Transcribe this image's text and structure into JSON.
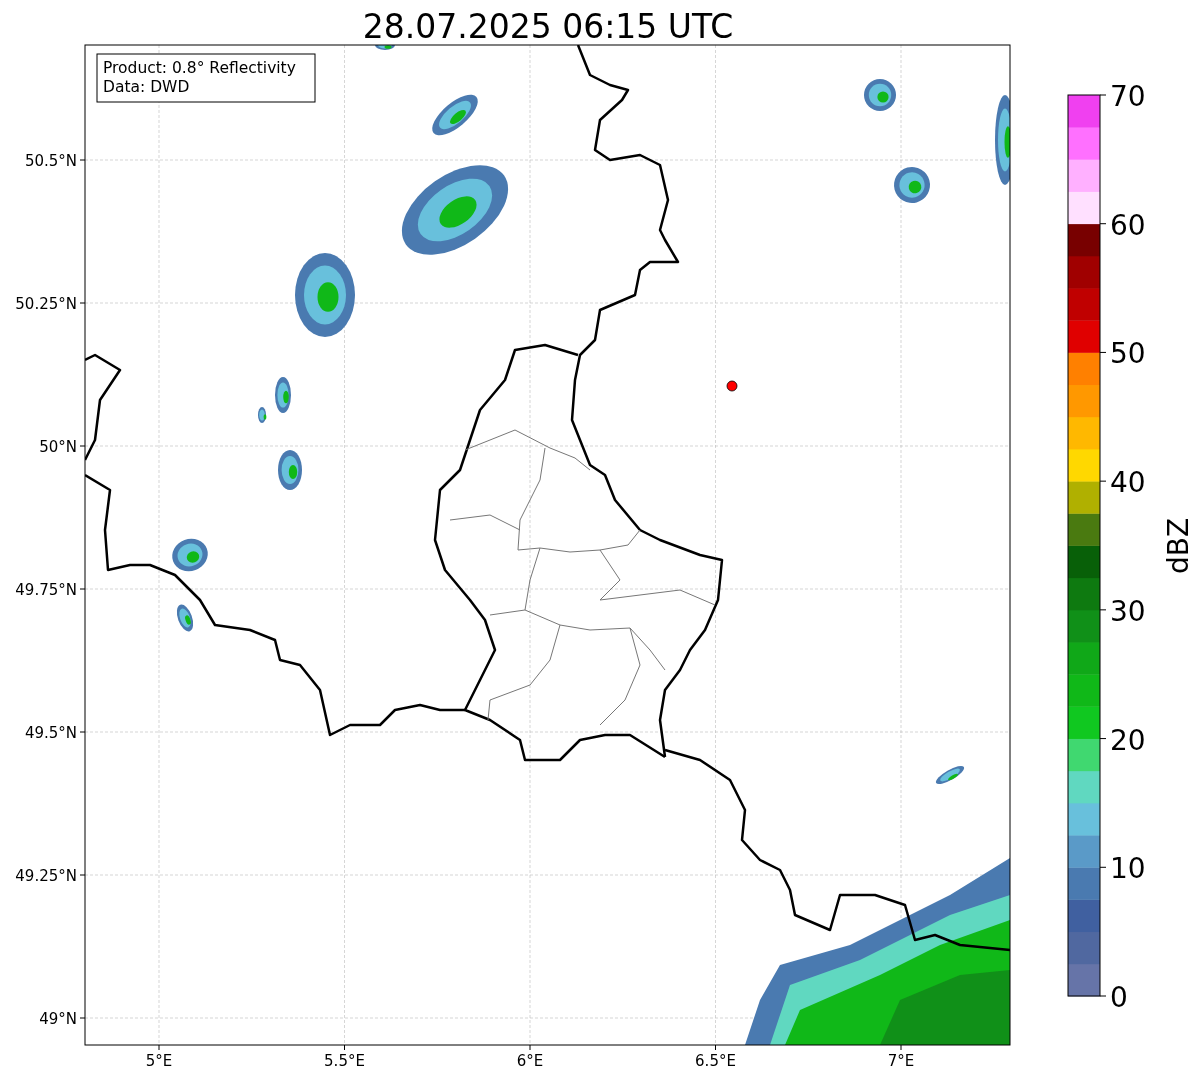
{
  "title": "28.07.2025 06:15 UTC",
  "info_box": [
    "Product: 0.8° Reflectivity",
    "Data: DWD"
  ],
  "map": {
    "x_ticks": [
      "5°E",
      "5.5°E",
      "6°E",
      "6.5°E",
      "7°E"
    ],
    "y_ticks": [
      "50.5°N",
      "50.25°N",
      "50°N",
      "49.75°N",
      "49.5°N",
      "49.25°N",
      "49°N"
    ]
  },
  "colorbar": {
    "label": "dBZ",
    "ticks": [
      "70",
      "60",
      "50",
      "40",
      "30",
      "20",
      "10",
      "0"
    ],
    "segments": [
      {
        "color": "#6674a8"
      },
      {
        "color": "#5068a0"
      },
      {
        "color": "#4060a0"
      },
      {
        "color": "#4a7ab0"
      },
      {
        "color": "#5a9ac8"
      },
      {
        "color": "#68c0dc"
      },
      {
        "color": "#60d8c0"
      },
      {
        "color": "#40d870"
      },
      {
        "color": "#10c820"
      },
      {
        "color": "#10b818"
      },
      {
        "color": "#10a818"
      },
      {
        "color": "#109018"
      },
      {
        "color": "#0e7a10"
      },
      {
        "color": "#086008"
      },
      {
        "color": "#4a7a10"
      },
      {
        "color": "#b0b000"
      },
      {
        "color": "#ffd800"
      },
      {
        "color": "#ffb800"
      },
      {
        "color": "#ff9800"
      },
      {
        "color": "#ff8000"
      },
      {
        "color": "#e00000"
      },
      {
        "color": "#c00000"
      },
      {
        "color": "#a00000"
      },
      {
        "color": "#780000"
      },
      {
        "color": "#ffe0ff"
      },
      {
        "color": "#ffb0ff"
      },
      {
        "color": "#ff70ff"
      },
      {
        "color": "#f040f0"
      }
    ]
  }
}
